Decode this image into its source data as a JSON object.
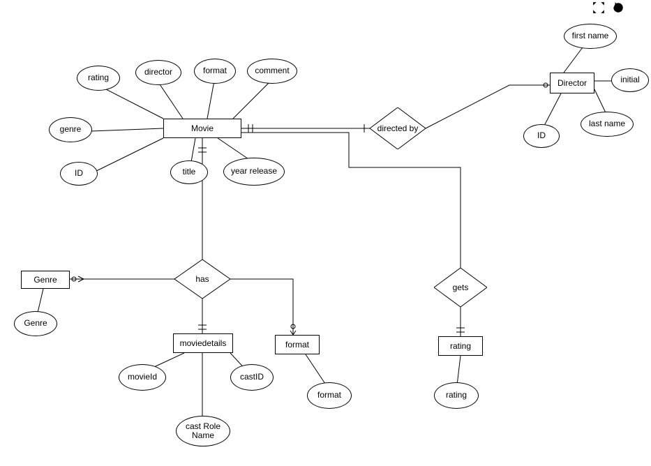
{
  "toolbar": {
    "maximize_icon": "maximize",
    "reset_icon": "reset",
    "close_icon": "close"
  },
  "entities": {
    "movie": {
      "label": "Movie"
    },
    "director": {
      "label": "Director"
    },
    "genre": {
      "label": "Genre"
    },
    "moviedetails": {
      "label": "moviedetails"
    },
    "format": {
      "label": "format"
    },
    "rating": {
      "label": "rating"
    }
  },
  "relationships": {
    "directed_by": {
      "label": "directed by"
    },
    "has": {
      "label": "has"
    },
    "gets": {
      "label": "gets"
    }
  },
  "attributes": {
    "movie_rating": {
      "label": "rating"
    },
    "movie_director": {
      "label": "director"
    },
    "movie_format": {
      "label": "format"
    },
    "movie_comment": {
      "label": "comment"
    },
    "movie_genre": {
      "label": "genre"
    },
    "movie_id": {
      "label": "ID"
    },
    "movie_title": {
      "label": "title"
    },
    "movie_year_release": {
      "label": "year release"
    },
    "director_first_name": {
      "label": "first name"
    },
    "director_initial": {
      "label": "initial"
    },
    "director_last_name": {
      "label": "last name"
    },
    "director_id": {
      "label": "ID"
    },
    "genre_genre": {
      "label": "Genre"
    },
    "moviedetails_movieid": {
      "label": "movieId"
    },
    "moviedetails_castid": {
      "label": "castID"
    },
    "moviedetails_cast_role_name": {
      "label": "cast Role\nName"
    },
    "format_format": {
      "label": "format"
    },
    "rating_rating": {
      "label": "rating"
    }
  }
}
